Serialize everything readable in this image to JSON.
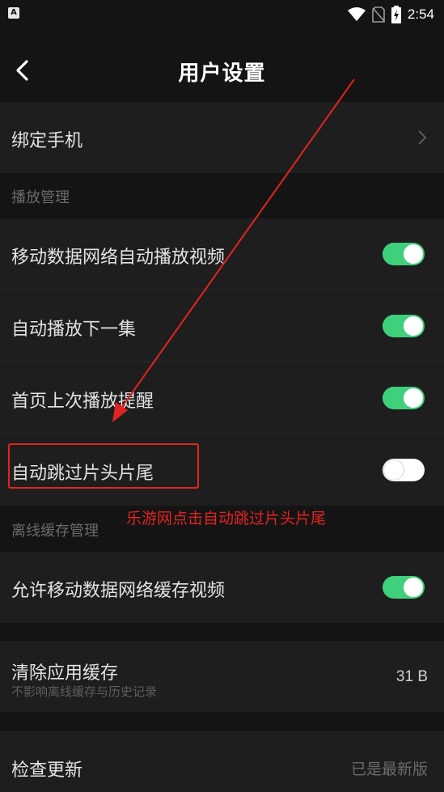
{
  "status_bar": {
    "app_badge": "A",
    "time": "2:54",
    "icons": [
      "wifi-icon",
      "no-sim-icon",
      "battery-charging-icon"
    ]
  },
  "header": {
    "title": "用户设置",
    "back_icon": "chevron-left-icon"
  },
  "bind_phone": {
    "label": "绑定手机"
  },
  "playback_section": {
    "title": "播放管理",
    "items": [
      {
        "label": "移动数据网络自动播放视频",
        "enabled": true
      },
      {
        "label": "自动播放下一集",
        "enabled": true
      },
      {
        "label": "首页上次播放提醒",
        "enabled": true
      },
      {
        "label": "自动跳过片头片尾",
        "enabled": false
      }
    ]
  },
  "offline_section": {
    "title": "离线缓存管理",
    "items": [
      {
        "label": "允许移动数据网络缓存视频",
        "enabled": true
      }
    ]
  },
  "clear_cache": {
    "label": "清除应用缓存",
    "sublabel": "不影响离线缓存与历史记录",
    "value": "31 B"
  },
  "check_update": {
    "label": "检查更新",
    "value": "已是最新版"
  },
  "annotation": {
    "text": "乐游网点击自动跳过片头片尾",
    "color": "#e32323"
  },
  "colors": {
    "background": "#141414",
    "row": "#1e1e1e",
    "toggle_on": "#3ed07a"
  }
}
